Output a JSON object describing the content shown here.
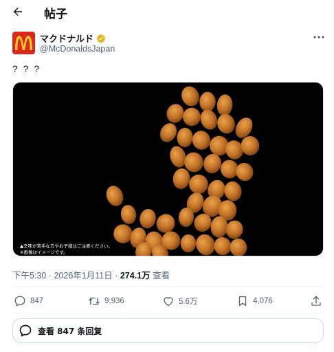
{
  "header": {
    "title": "帖子",
    "back_icon": "arrow-left-icon"
  },
  "author": {
    "display_name": "マクドナルド",
    "handle": "@McDonaldsJapan",
    "verified_color": "#e2b719",
    "brand_color": "#da291c",
    "logo_color": "#ffc72c"
  },
  "tweet": {
    "text": "? ? ?",
    "media": {
      "caption_line1": "▲辛味が苦手な方やお子様はご注意ください。",
      "caption_line2": "※画像はイメージです。"
    }
  },
  "meta": {
    "time": "下午5:30",
    "separator": "·",
    "date": "2026年1月11日",
    "views_count": "274.1万",
    "views_label": "查看"
  },
  "actions": {
    "replies": "847",
    "retweets": "9,936",
    "likes": "5.6万",
    "bookmarks": "4,076"
  },
  "replies_button": {
    "label": "查看 847 条回复"
  }
}
